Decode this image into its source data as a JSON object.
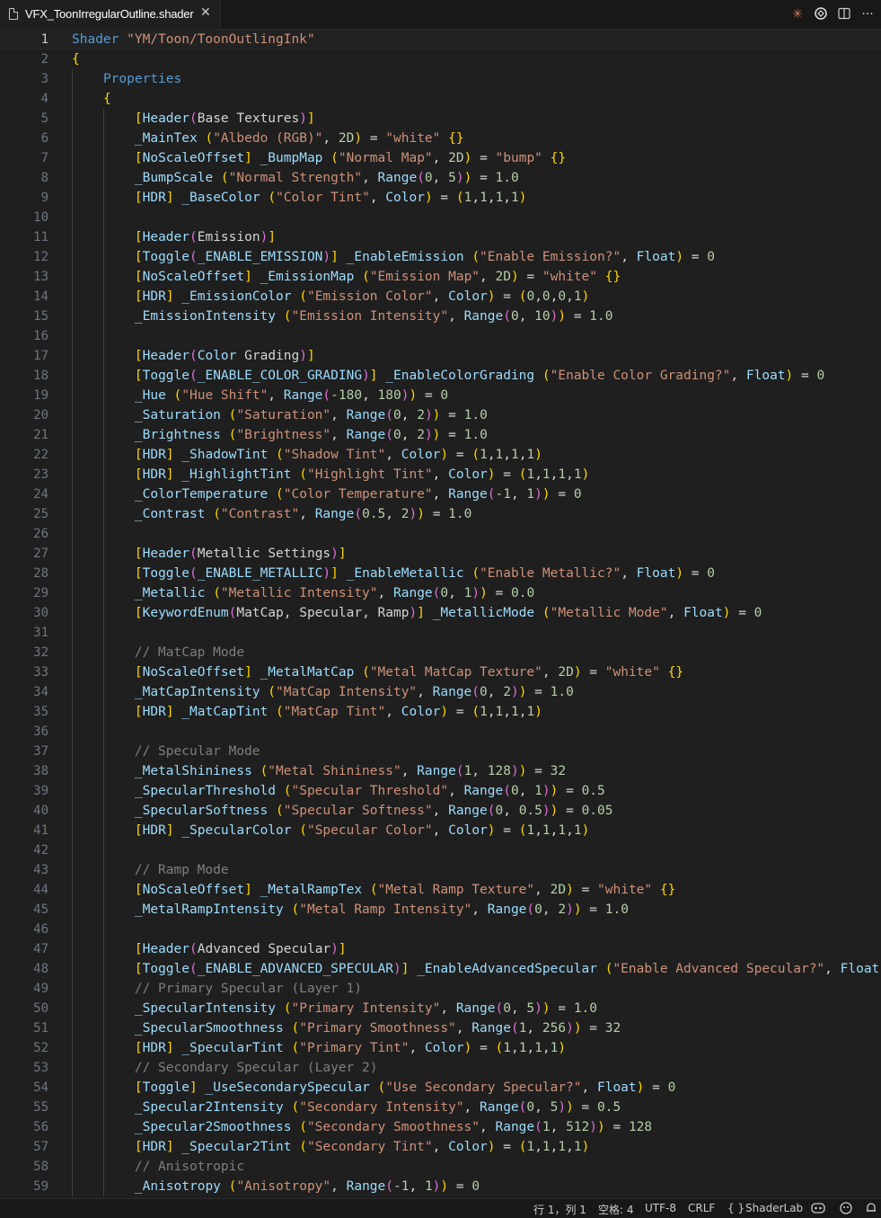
{
  "tab": {
    "title": "VFX_ToonIrregularOutline.shader",
    "close": "✕",
    "icons": [
      "claude-icon",
      "openai-icon",
      "split-editor-icon",
      "more-actions-icon"
    ]
  },
  "editor": {
    "lines": [
      "Shader \"YM/Toon/ToonOutlingInk\"",
      "{",
      "    Properties",
      "    {",
      "        [Header(Base Textures)]",
      "        _MainTex (\"Albedo (RGB)\", 2D) = \"white\" {}",
      "        [NoScaleOffset] _BumpMap (\"Normal Map\", 2D) = \"bump\" {}",
      "        _BumpScale (\"Normal Strength\", Range(0, 5)) = 1.0",
      "        [HDR] _BaseColor (\"Color Tint\", Color) = (1,1,1,1)",
      "",
      "        [Header(Emission)]",
      "        [Toggle(_ENABLE_EMISSION)] _EnableEmission (\"Enable Emission?\", Float) = 0",
      "        [NoScaleOffset] _EmissionMap (\"Emission Map\", 2D) = \"white\" {}",
      "        [HDR] _EmissionColor (\"Emission Color\", Color) = (0,0,0,1)",
      "        _EmissionIntensity (\"Emission Intensity\", Range(0, 10)) = 1.0",
      "",
      "        [Header(Color Grading)]",
      "        [Toggle(_ENABLE_COLOR_GRADING)] _EnableColorGrading (\"Enable Color Grading?\", Float) = 0",
      "        _Hue (\"Hue Shift\", Range(-180, 180)) = 0",
      "        _Saturation (\"Saturation\", Range(0, 2)) = 1.0",
      "        _Brightness (\"Brightness\", Range(0, 2)) = 1.0",
      "        [HDR] _ShadowTint (\"Shadow Tint\", Color) = (1,1,1,1)",
      "        [HDR] _HighlightTint (\"Highlight Tint\", Color) = (1,1,1,1)",
      "        _ColorTemperature (\"Color Temperature\", Range(-1, 1)) = 0",
      "        _Contrast (\"Contrast\", Range(0.5, 2)) = 1.0",
      "",
      "        [Header(Metallic Settings)]",
      "        [Toggle(_ENABLE_METALLIC)] _EnableMetallic (\"Enable Metallic?\", Float) = 0",
      "        _Metallic (\"Metallic Intensity\", Range(0, 1)) = 0.0",
      "        [KeywordEnum(MatCap, Specular, Ramp)] _MetallicMode (\"Metallic Mode\", Float) = 0",
      "",
      "        // MatCap Mode",
      "        [NoScaleOffset] _MetalMatCap (\"Metal MatCap Texture\", 2D) = \"white\" {}",
      "        _MatCapIntensity (\"MatCap Intensity\", Range(0, 2)) = 1.0",
      "        [HDR] _MatCapTint (\"MatCap Tint\", Color) = (1,1,1,1)",
      "",
      "        // Specular Mode",
      "        _MetalShininess (\"Metal Shininess\", Range(1, 128)) = 32",
      "        _SpecularThreshold (\"Specular Threshold\", Range(0, 1)) = 0.5",
      "        _SpecularSoftness (\"Specular Softness\", Range(0, 0.5)) = 0.05",
      "        [HDR] _SpecularColor (\"Specular Color\", Color) = (1,1,1,1)",
      "",
      "        // Ramp Mode",
      "        [NoScaleOffset] _MetalRampTex (\"Metal Ramp Texture\", 2D) = \"white\" {}",
      "        _MetalRampIntensity (\"Metal Ramp Intensity\", Range(0, 2)) = 1.0",
      "",
      "        [Header(Advanced Specular)]",
      "        [Toggle(_ENABLE_ADVANCED_SPECULAR)] _EnableAdvancedSpecular (\"Enable Advanced Specular?\", Float",
      "        // Primary Specular (Layer 1)",
      "        _SpecularIntensity (\"Primary Intensity\", Range(0, 5)) = 1.0",
      "        _SpecularSmoothness (\"Primary Smoothness\", Range(1, 256)) = 32",
      "        [HDR] _SpecularTint (\"Primary Tint\", Color) = (1,1,1,1)",
      "        // Secondary Specular (Layer 2)",
      "        [Toggle] _UseSecondarySpecular (\"Use Secondary Specular?\", Float) = 0",
      "        _Specular2Intensity (\"Secondary Intensity\", Range(0, 5)) = 0.5",
      "        _Specular2Smoothness (\"Secondary Smoothness\", Range(1, 512)) = 128",
      "        [HDR] _Specular2Tint (\"Secondary Tint\", Color) = (1,1,1,1)",
      "        // Anisotropic",
      "        _Anisotropy (\"Anisotropy\", Range(-1, 1)) = 0"
    ]
  },
  "status": {
    "position": "行 1，列 1",
    "spaces": "空格: 4",
    "encoding": "UTF-8",
    "eol": "CRLF",
    "language_icon": "{ }",
    "language": "ShaderLab",
    "icons": [
      "copilot-icon",
      "feedback-icon",
      "bell-icon"
    ]
  }
}
